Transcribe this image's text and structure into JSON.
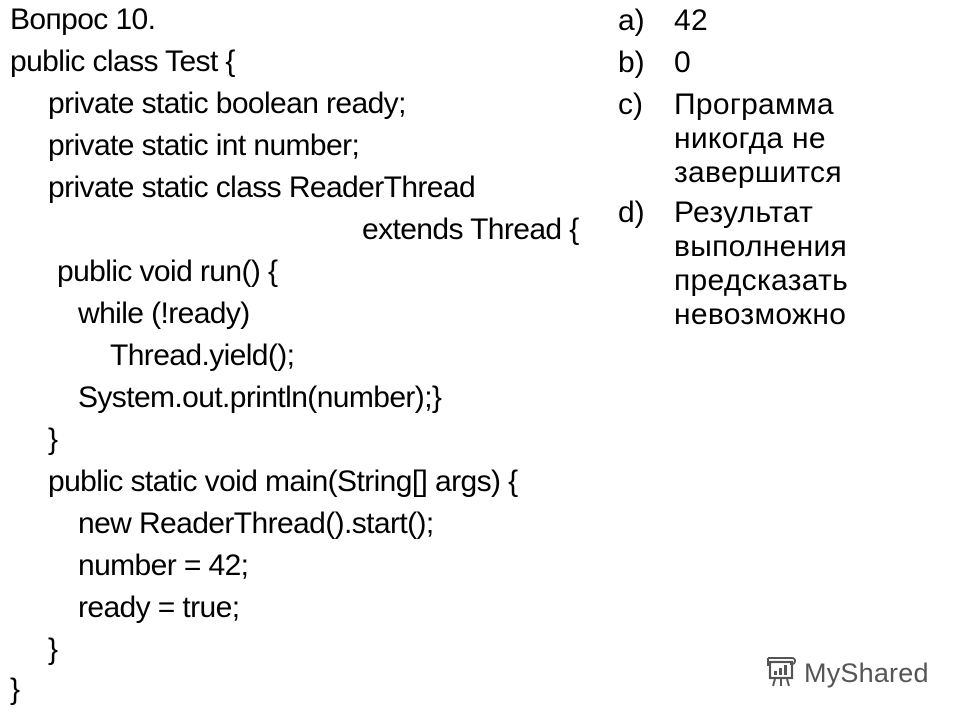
{
  "question": {
    "title": "Вопрос 10.",
    "code_lines": [
      "public class Test {",
      "private static boolean ready;",
      "private static int number;",
      "private static class ReaderThread",
      "extends Thread {",
      "public void run() {",
      "while (!ready)",
      "Thread.yield();",
      "System.out.println(number);}",
      "}",
      "public static void main(String[] args) {",
      "new ReaderThread().start();",
      "number = 42;",
      "ready = true;",
      "}",
      "}"
    ]
  },
  "options": [
    {
      "label": "a)",
      "text": "42"
    },
    {
      "label": "b)",
      "text": "0"
    },
    {
      "label": "c)",
      "text": "Программа\nникогда не\nзавершится"
    },
    {
      "label": "d)",
      "text": "Результат\nвыполнения\nпредсказать\nневозможно"
    }
  ],
  "watermark": {
    "text": "MyShared",
    "icon": "presentation-board-icon"
  }
}
